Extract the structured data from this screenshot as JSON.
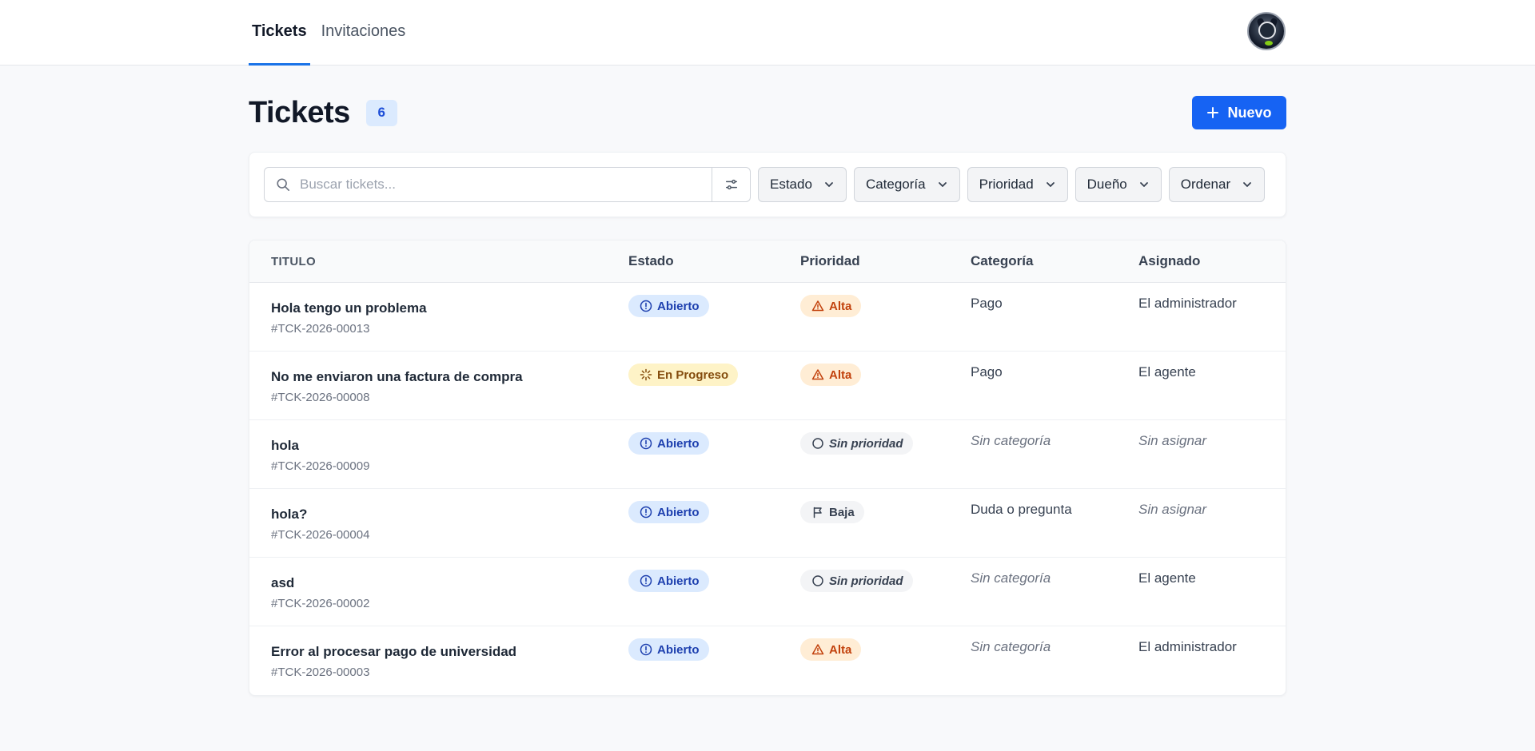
{
  "nav": {
    "tabs": [
      {
        "label": "Tickets",
        "active": true
      },
      {
        "label": "Invitaciones",
        "active": false
      }
    ]
  },
  "header": {
    "title": "Tickets",
    "count": "6",
    "new_button_label": "Nuevo"
  },
  "filters": {
    "search_placeholder": "Buscar tickets...",
    "search_value": "",
    "dropdowns": [
      "Estado",
      "Categoría",
      "Prioridad",
      "Dueño",
      "Ordenar"
    ]
  },
  "table": {
    "columns": [
      "TITULO",
      "Estado",
      "Prioridad",
      "Categoría",
      "Asignado"
    ],
    "rows": [
      {
        "title": "Hola tengo un problema",
        "id": "#TCK-2026-00013",
        "status": "Abierto",
        "priority": "Alta",
        "category": "Pago",
        "assignee": "El administrador"
      },
      {
        "title": "No me enviaron una factura de compra",
        "id": "#TCK-2026-00008",
        "status": "En Progreso",
        "priority": "Alta",
        "category": "Pago",
        "assignee": "El agente"
      },
      {
        "title": "hola",
        "id": "#TCK-2026-00009",
        "status": "Abierto",
        "priority": "Sin prioridad",
        "category": "Sin categoría",
        "assignee": "Sin asignar"
      },
      {
        "title": "hola?",
        "id": "#TCK-2026-00004",
        "status": "Abierto",
        "priority": "Baja",
        "category": "Duda o pregunta",
        "assignee": "Sin asignar"
      },
      {
        "title": "asd",
        "id": "#TCK-2026-00002",
        "status": "Abierto",
        "priority": "Sin prioridad",
        "category": "Sin categoría",
        "assignee": "El agente"
      },
      {
        "title": "Error al procesar pago de universidad",
        "id": "#TCK-2026-00003",
        "status": "Abierto",
        "priority": "Alta",
        "category": "Sin categoría",
        "assignee": "El administrador"
      }
    ]
  },
  "colors": {
    "accent": "#1663f3",
    "tab_underline": "#1a73e8",
    "status_open_bg": "#dbeafe",
    "status_progress_bg": "#fef3c7",
    "priority_high_bg": "#ffedd5"
  },
  "icons": {
    "search": "search-icon",
    "filter": "sliders-icon",
    "chevron": "chevron-down-icon",
    "plus": "plus-icon",
    "open": "alert-circle-icon",
    "progress": "loader-icon",
    "high": "warning-triangle-icon",
    "none": "circle-icon",
    "low": "flag-icon"
  }
}
